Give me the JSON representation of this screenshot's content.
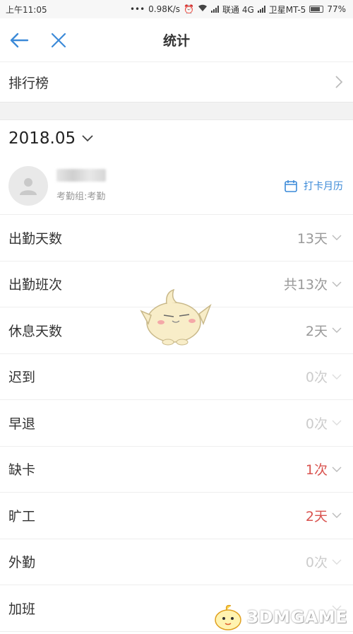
{
  "status_bar": {
    "time": "上午11:05",
    "speed": "0.98K/s",
    "carrier1": "联通 4G",
    "carrier2": "卫星MT-5",
    "battery": "77%"
  },
  "navbar": {
    "title": "统计"
  },
  "ranking": {
    "label": "排行榜"
  },
  "month": {
    "label": "2018.05"
  },
  "user": {
    "group": "考勤组:考勤",
    "calendar_label": "打卡月历"
  },
  "stats": [
    {
      "label": "出勤天数",
      "value": "13天",
      "style": "normal"
    },
    {
      "label": "出勤班次",
      "value": "共13次",
      "style": "normal"
    },
    {
      "label": "休息天数",
      "value": "2天",
      "style": "normal"
    },
    {
      "label": "迟到",
      "value": "0次",
      "style": "muted"
    },
    {
      "label": "早退",
      "value": "0次",
      "style": "muted"
    },
    {
      "label": "缺卡",
      "value": "1次",
      "style": "red"
    },
    {
      "label": "旷工",
      "value": "2天",
      "style": "red"
    },
    {
      "label": "外勤",
      "value": "0次",
      "style": "muted"
    },
    {
      "label": "加班",
      "value": "",
      "style": "muted"
    }
  ],
  "watermark": {
    "text": "3DMGAME"
  },
  "colors": {
    "accent": "#3c8ad8",
    "alert": "#d9534f",
    "muted": "#cccccc"
  }
}
